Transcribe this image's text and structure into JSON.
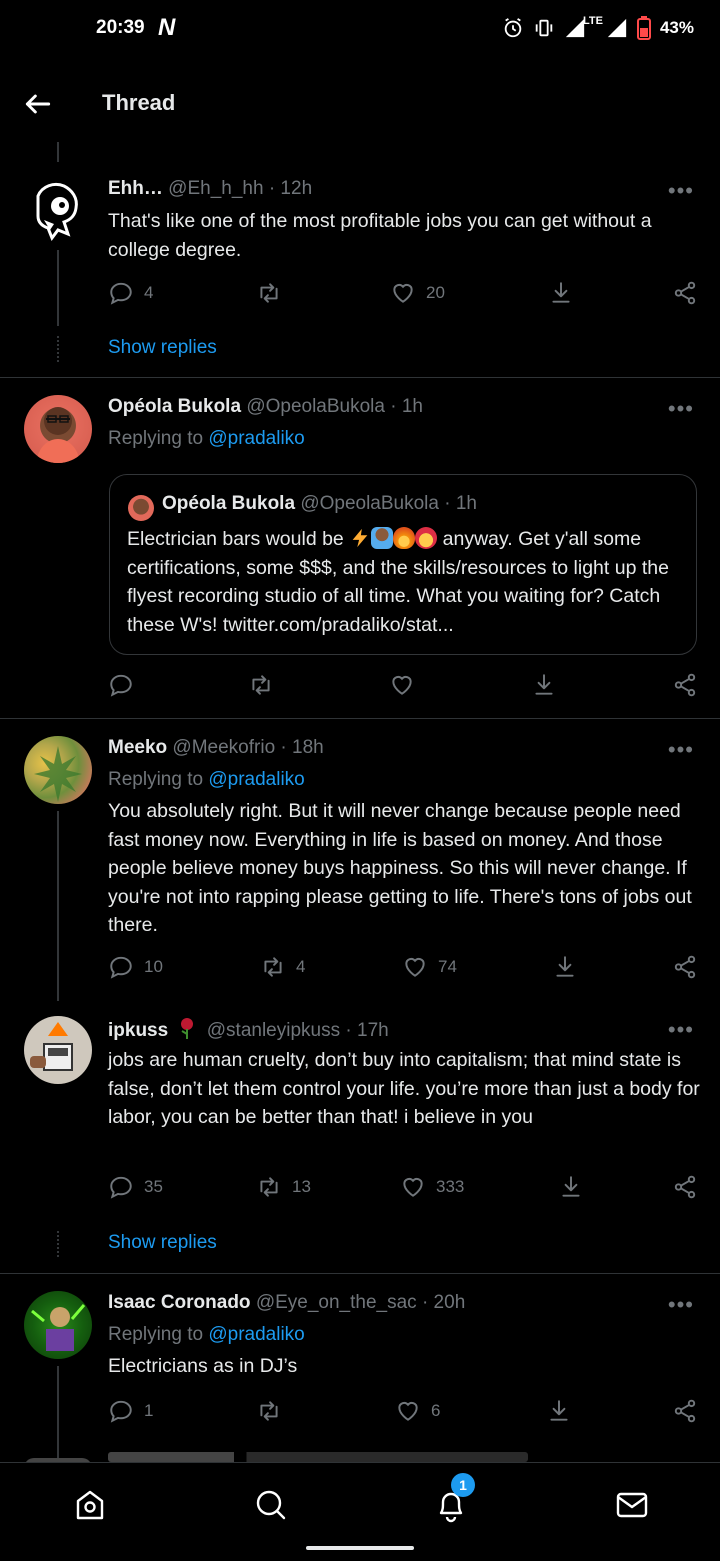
{
  "status_bar": {
    "time": "20:39",
    "carrier_logo": "N",
    "network": "LTE",
    "battery": "43%"
  },
  "header": {
    "title": "Thread"
  },
  "tweets": [
    {
      "name": "Ehh…",
      "handle": "@Eh_h_hh",
      "time": "· 12h",
      "text": "That's like one of the most profitable jobs you can get without a college degree.",
      "replies": "4",
      "retweets": "",
      "likes": "20",
      "show_replies": "Show replies"
    },
    {
      "name": "Opéola Bukola",
      "handle": "@OpeolaBukola",
      "time": "· 1h",
      "replying_label": "Replying to",
      "replying_to": "@pradaliko",
      "quote": {
        "name": "Opéola Bukola",
        "handle": "@OpeolaBukola",
        "time": "· 1h",
        "text_before": "Electrician bars would be",
        "emojis": [
          "high-voltage-emoji",
          "technologist-emoji",
          "fire-emoji",
          "exploding-head-emoji"
        ],
        "text_after": "anyway. Get y'all some certifications, some $$$, and the skills/resources to light up the flyest recording studio of all time. What you waiting for? Catch these W's! twitter.com/pradaliko/stat..."
      },
      "replies": "",
      "retweets": "",
      "likes": ""
    },
    {
      "name": "Meeko",
      "handle": "@Meekofrio",
      "time": "· 18h",
      "replying_label": "Replying to",
      "replying_to": "@pradaliko",
      "text": "You absolutely right. But it will never change because people need fast money now. Everything in life is based on money. And those people believe money buys happiness. So this will never change. If you're not into rapping please getting to life. There's tons of jobs out there.",
      "replies": "10",
      "retweets": "4",
      "likes": "74"
    },
    {
      "name": "ipkuss",
      "name_emoji": "rose-emoji",
      "handle": "@stanleyipkuss",
      "time": "· 17h",
      "text": "jobs are human cruelty, don’t buy into capitalism; that mind state is false, don’t let them control your life. you’re more than just a body for labor, you can be better than that! i believe in you",
      "replies": "35",
      "retweets": "13",
      "likes": "333",
      "show_replies": "Show replies"
    },
    {
      "name": "Isaac Coronado",
      "handle": "@Eye_on_the_sac",
      "time": "· 20h",
      "replying_label": "Replying to",
      "replying_to": "@pradaliko",
      "text": "Electricians as in DJ’s",
      "replies": "1",
      "retweets": "",
      "likes": "6"
    }
  ],
  "bottom_nav": {
    "items": [
      "home-icon",
      "search-icon",
      "notifications-icon",
      "messages-icon"
    ],
    "notification_badge": "1"
  },
  "colors": {
    "background": "#000000",
    "text": "#e7e9ea",
    "muted": "#71767b",
    "accent": "#1d9bf0"
  }
}
